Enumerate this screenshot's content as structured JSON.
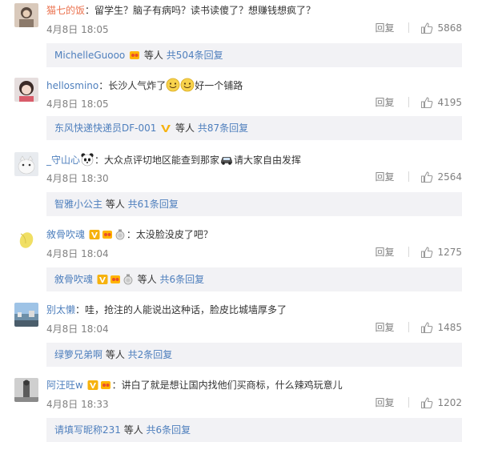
{
  "comments": [
    {
      "username": "猫七的饭",
      "text": "：留学生？脑子有病吗？读书读傻了？想赚钱想疯了？",
      "time": "4月8日 18:05",
      "reply_label": "回复",
      "likes": "5868",
      "sub": {
        "user": "MichelleGuooo",
        "mid": " 等人",
        "more": " 共504条回复"
      }
    },
    {
      "username": "hellosmino",
      "text_pre": "：长沙人气炸了",
      "text_post": "好一个铺路",
      "time": "4月8日 18:05",
      "reply_label": "回复",
      "likes": "4195",
      "sub": {
        "user": "东风快递快递员DF-001",
        "mid": " 等人",
        "more": " 共87条回复"
      }
    },
    {
      "username": "_守山心",
      "text_pre": "：大众点评切地区能查到那家",
      "text_post": "请大家自由发挥",
      "time": "4月8日 18:30",
      "reply_label": "回复",
      "likes": "2564",
      "sub": {
        "user": "智雅小公主",
        "mid": " 等人",
        "more": " 共61条回复"
      }
    },
    {
      "username": "敘骨吹魂",
      "text": "：太没脸没皮了吧？",
      "time": "4月8日 18:04",
      "reply_label": "回复",
      "likes": "1275",
      "sub": {
        "user": "敘骨吹魂",
        "mid": " 等人",
        "more": " 共6条回复"
      }
    },
    {
      "username": "别太懒",
      "text": "：哇，抢注的人能说出这种话，脸皮比城墙厚多了",
      "time": "4月8日 18:04",
      "reply_label": "回复",
      "likes": "1485",
      "sub": {
        "user": "绿箩兄弟啊",
        "mid": " 等人",
        "more": " 共2条回复"
      }
    },
    {
      "username": "阿汪旺w",
      "text": "：讲白了就是想让国内找他们买商标，什么辣鸡玩意儿",
      "time": "4月8日 18:33",
      "reply_label": "回复",
      "likes": "1202",
      "sub": {
        "user": "请填写昵称231",
        "mid": " 等人",
        "more": " 共6条回复"
      }
    }
  ],
  "colors": {
    "username": "#eb7350",
    "link": "#4e7fbd",
    "meta": "#808080",
    "subbox_bg": "#f2f2f5"
  },
  "icons": [
    "like-thumb-icon",
    "vip-badge-icon",
    "fan-badge-icon",
    "medal-badge-icon",
    "smile-emoji-icon",
    "panda-emoji-icon",
    "car-emoji-icon"
  ]
}
